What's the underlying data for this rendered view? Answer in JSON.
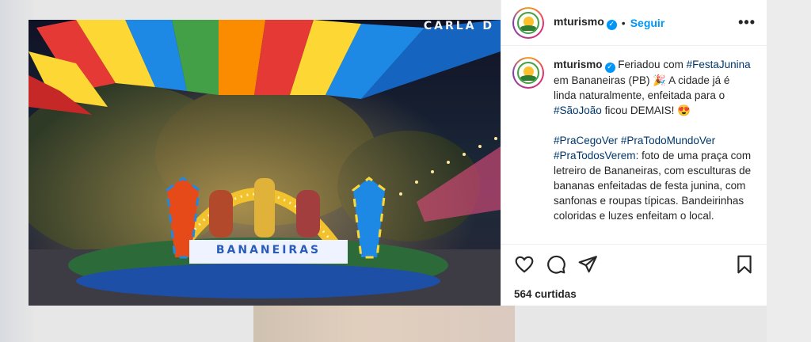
{
  "post": {
    "media": {
      "watermark": "CARLA D",
      "sign_text": "BANANEIRAS"
    },
    "header": {
      "username": "mturismo",
      "separator": "•",
      "follow_label": "Seguir",
      "more_label": "•••"
    },
    "caption": {
      "username": "mturismo",
      "p1_a": "Feriadou com ",
      "tag_festa": "#FestaJunina",
      "p1_b": " em Bananeiras (PB) 🎉 A cidade já é linda naturalmente, enfeitada para o ",
      "tag_saojoao": "#SãoJoão",
      "p1_c": " ficou DEMAIS! 😍",
      "tag_cego": "#PraCegoVer",
      "tag_todo": "#PraTodoMundoVer",
      "tag_verem": "#PraTodosVerem",
      "p2_text": ": foto de uma praça com letreiro de Bananeiras, com esculturas de bananas enfeitadas de festa junina, com sanfonas e roupas típicas. Bandeirinhas coloridas e luzes enfeitam o local."
    },
    "likes_text": "564 curtidas",
    "colors": {
      "accent": "#0095f6",
      "hashtag": "#00376b",
      "text": "#262626"
    },
    "icons": [
      "verified-icon",
      "more-icon",
      "heart-icon",
      "comment-icon",
      "share-icon",
      "bookmark-icon"
    ]
  }
}
